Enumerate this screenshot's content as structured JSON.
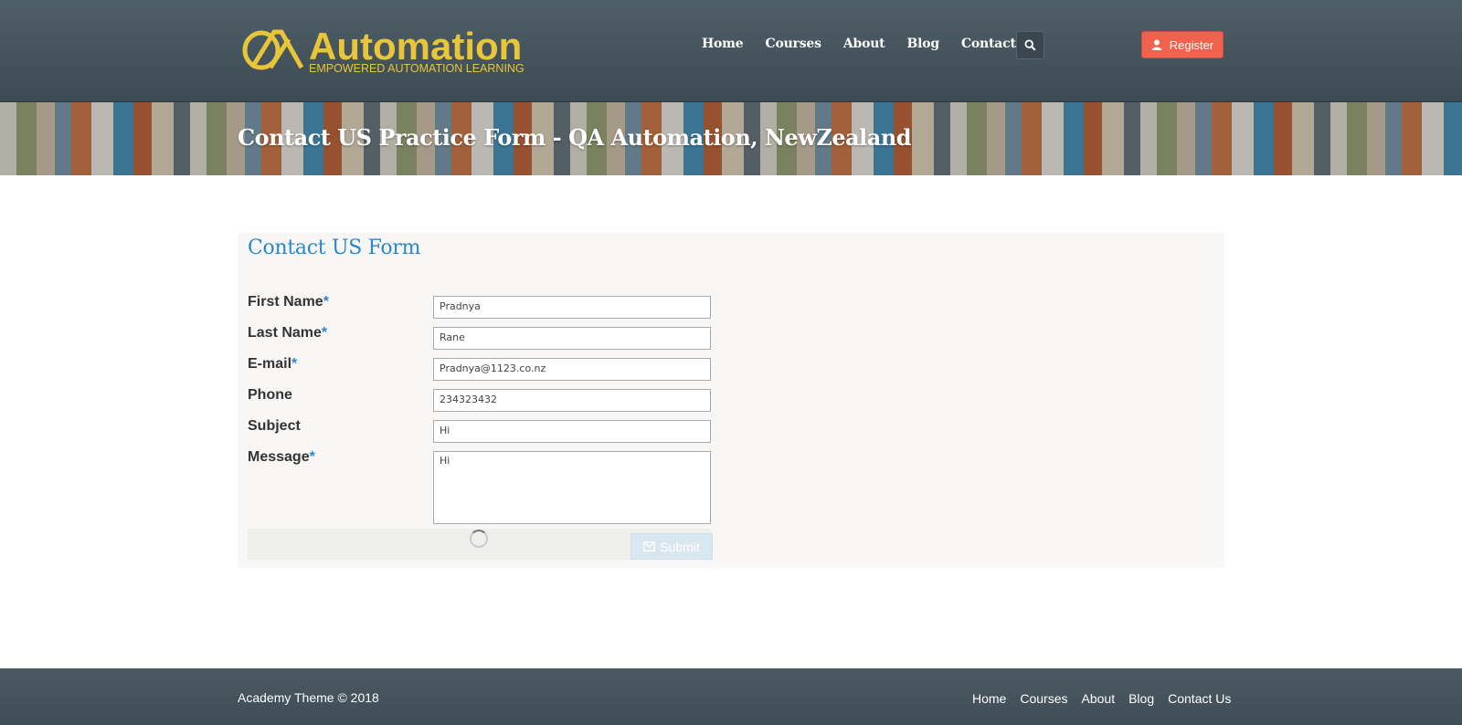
{
  "brand": {
    "logo_text": "Automation",
    "logo_tagline": "EMPOWERED AUTOMATION LEARNING",
    "logo_color": "#e9c53a"
  },
  "nav": {
    "items": [
      "Home",
      "Courses",
      "About",
      "Blog",
      "Contact Us"
    ],
    "search_icon": "search-icon",
    "register_label": "Register",
    "register_icon": "user-icon"
  },
  "banner": {
    "title": "Contact US Practice Form - QA Automation, NewZealand"
  },
  "form": {
    "heading": "Contact US Form",
    "required_mark": "*",
    "fields": [
      {
        "label": "First Name",
        "value": "Pradnya",
        "required": true
      },
      {
        "label": "Last Name",
        "value": "Rane",
        "required": true
      },
      {
        "label": "E-mail",
        "value": "Pradnya@1123.co.nz",
        "required": true
      },
      {
        "label": "Phone",
        "value": "234323432",
        "required": false
      },
      {
        "label": "Subject",
        "value": "Hi",
        "required": false
      },
      {
        "label": "Message",
        "value": "Hi",
        "required": true
      }
    ],
    "submit_label": "Submit",
    "submit_icon": "envelope-icon",
    "loading_icon": "spinner-icon"
  },
  "footer": {
    "copyright": "Academy Theme © 2018",
    "links": [
      "Home",
      "Courses",
      "About",
      "Blog",
      "Contact Us"
    ]
  },
  "colors": {
    "header_bg": "#45545c",
    "accent_blue": "#2a88c9",
    "register_red": "#f0614e"
  }
}
